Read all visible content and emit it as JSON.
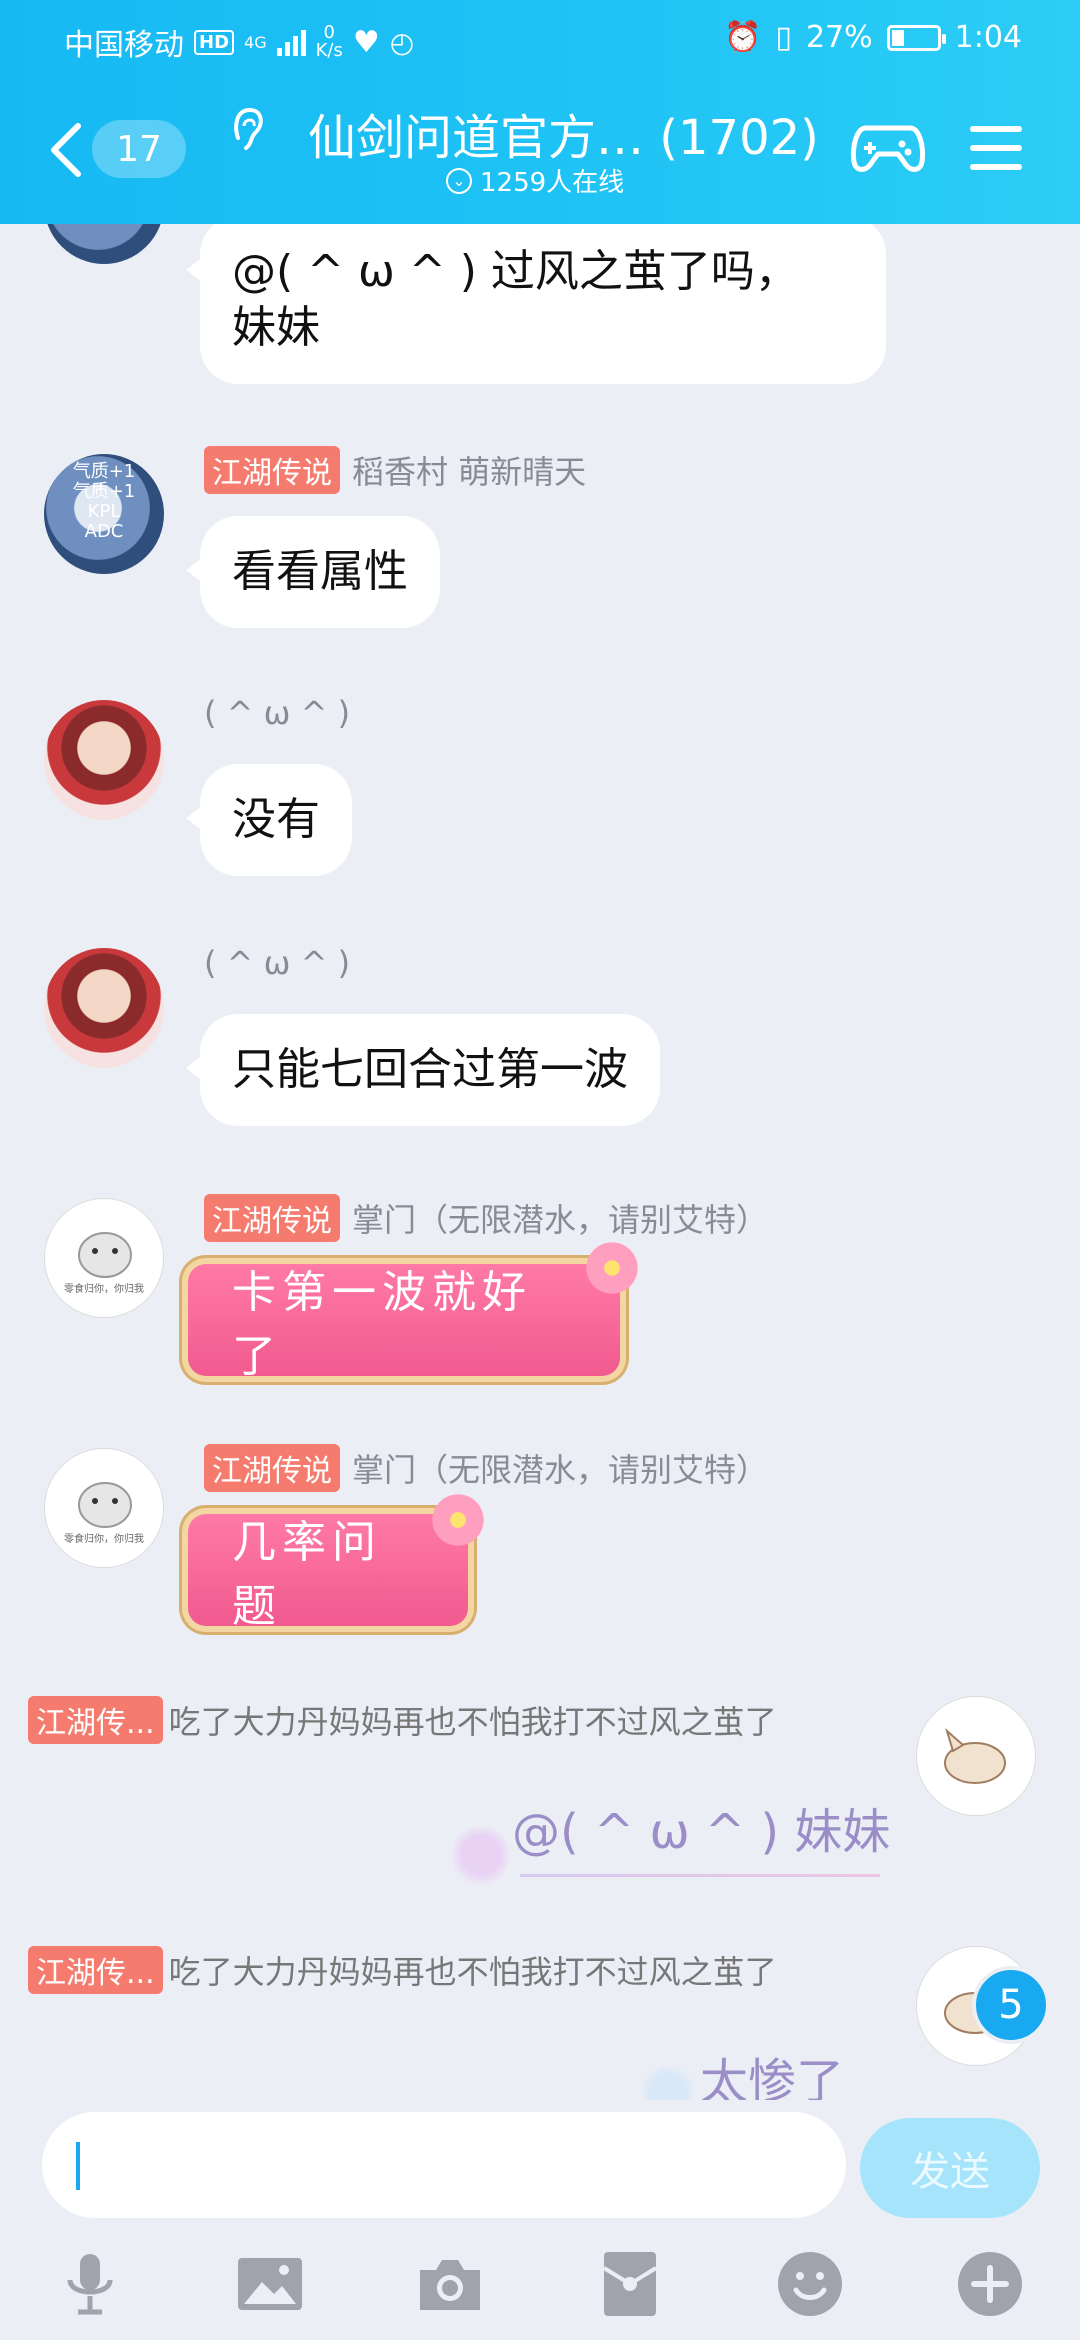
{
  "status_bar": {
    "carrier": "中国移动",
    "hd": "HD",
    "network": "4G",
    "speed_value": "0",
    "speed_unit": "K/s",
    "battery": "27%",
    "battery_level": 0.27,
    "time": "1:04"
  },
  "header": {
    "unread_count": "17",
    "title": "仙剑问道官方… (1702)",
    "online": "1259人在线"
  },
  "messages": [
    {
      "text_lines": [
        "@( ^ ω ^ ) 过风之茧了吗，",
        "妹妹"
      ]
    },
    {
      "tag": "江湖传说",
      "sender": "稻香村  萌新晴天",
      "text": "看看属性",
      "avatar_lines": [
        "气质+1",
        "气质+1",
        "KPL",
        "ADC"
      ]
    },
    {
      "sender": "( ^ ω ^ )",
      "text": "没有"
    },
    {
      "sender": "( ^ ω ^ )",
      "text": "只能七回合过第一波"
    },
    {
      "tag": "江湖传说",
      "sender": "掌门（无限潜水，请别艾特）",
      "text": "卡第一波就好了",
      "avatar_caption": "零食归你，你归我"
    },
    {
      "tag": "江湖传说",
      "sender": "掌门（无限潜水，请别艾特）",
      "text": "几率问题",
      "avatar_caption": "零食归你，你归我"
    }
  ],
  "right_messages": [
    {
      "tag": "江湖传...",
      "text": "吃了大力丹妈妈再也不怕我打不过风之茧了",
      "mention": "@( ^ ω ^ ) 妹妹"
    },
    {
      "tag": "江湖传...",
      "text": "吃了大力丹妈妈再也不怕我打不过风之茧了",
      "mention": "太惨了"
    }
  ],
  "new_message_badge": "5",
  "input": {
    "value": "",
    "send_label": "发送"
  },
  "toolbar": [
    "mic-icon",
    "image-icon",
    "camera-icon",
    "red-packet-icon",
    "emoji-icon",
    "plus-icon"
  ],
  "colors": {
    "header_start": "#17b9f3",
    "header_end": "#2ccdf6",
    "tag": "#f47b6e",
    "badge": "#18a9f0",
    "send_button": "#a6e4fb"
  }
}
